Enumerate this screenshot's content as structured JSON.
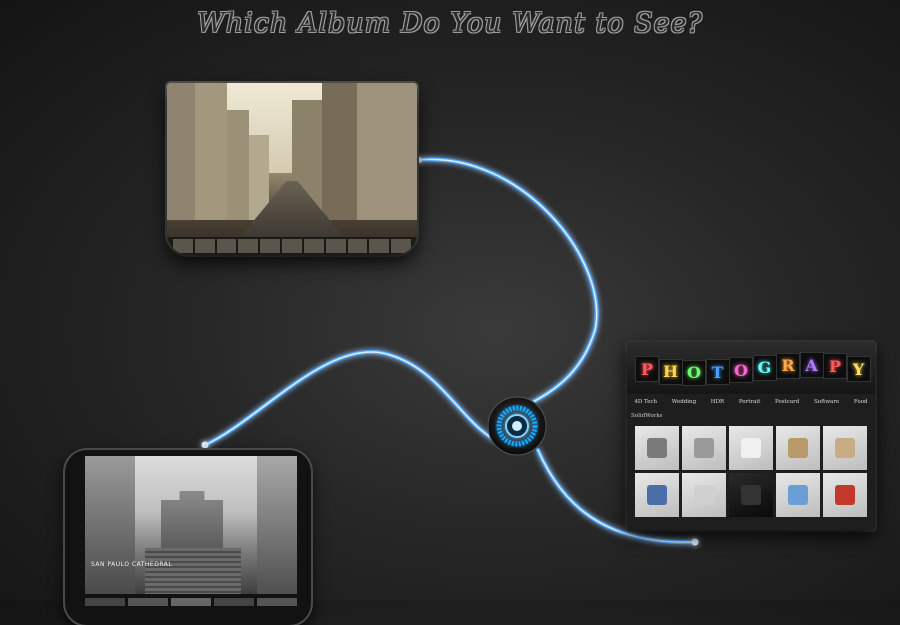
{
  "page": {
    "heading": "Which Album Do You Want to See?"
  },
  "colors": {
    "wire": "#5fb8ff",
    "wire_glow": "#2d86e0",
    "hub": "#1aa7ff"
  },
  "albums": {
    "city": {
      "icon": "city-street-photo"
    },
    "church": {
      "caption": "SAN PAULO CATHEDRAL",
      "icon": "ruins-facade-photo"
    },
    "site": {
      "banner_letters": [
        "P",
        "H",
        "O",
        "T",
        "O",
        "G",
        "R",
        "A",
        "P",
        "Y"
      ],
      "banner_colors": [
        "#ff5a5a",
        "#ffd24a",
        "#6cff6c",
        "#4aa0ff",
        "#ff66cc",
        "#66ffff",
        "#ffa84a",
        "#b07bff",
        "#ff5a5a",
        "#ffe066"
      ],
      "nav": [
        "4D Tech",
        "Wedding",
        "HDR",
        "Portrait",
        "Postcard",
        "Software",
        "Food"
      ],
      "subheading": "SolidWorks",
      "thumbnails": [
        "drill-part",
        "paper-clip",
        "pin-part",
        "wooden-stool",
        "wooden-chair",
        "whistle",
        "usb-plug",
        "dark-part",
        "toy-plane",
        "toy-car"
      ]
    }
  },
  "hub": {
    "icon": "camera-lens-icon"
  }
}
